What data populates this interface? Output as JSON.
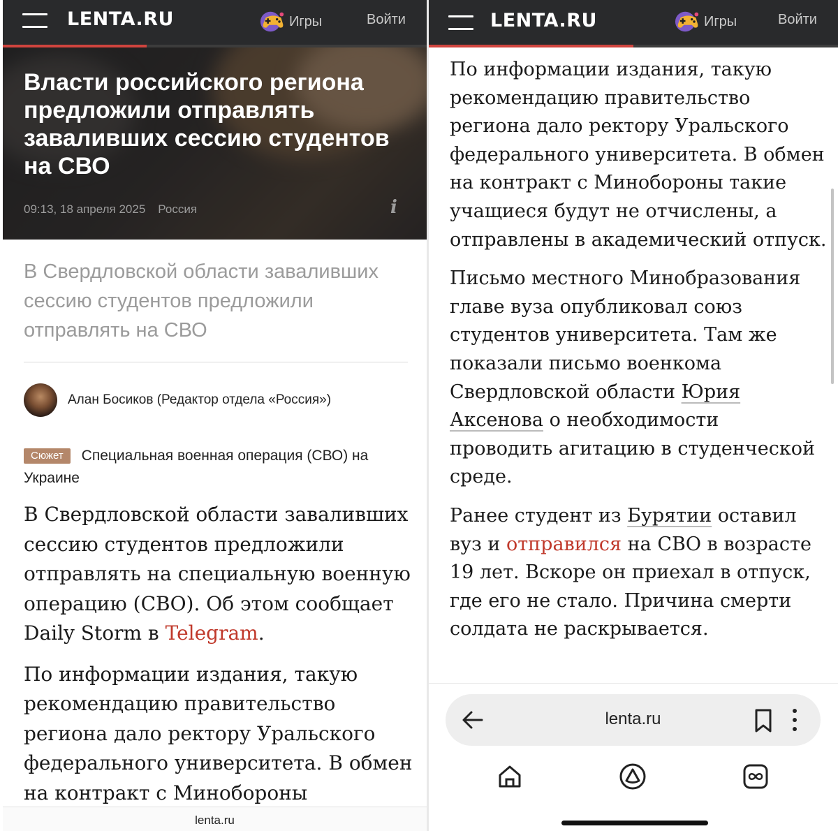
{
  "left": {
    "header": {
      "logo": "LENTA.RU",
      "games_label": "Игры",
      "login_label": "Войти"
    },
    "reading_progress_percent": 34,
    "article": {
      "title": "Власти российского региона предложили отправлять заваливших сессию студентов на СВО",
      "datetime": "09:13, 18 апреля 2025",
      "rubric": "Россия",
      "info_glyph": "i",
      "lead": "В Свердловской области заваливших сессию студентов предложили отправлять на СВО",
      "author": "Алан Босиков (Редактор отдела «Россия»)",
      "story_badge": "Сюжет",
      "story_title": "Специальная военная операция (СВО) на Украине",
      "p1_text": "В Свердловской области заваливших сессию студентов предложили отправлять на специальную военную операцию (СВО). Об этом сообщает Daily Storm в ",
      "p1_link": "Telegram",
      "p1_end": ".",
      "p2": "По информации издания, такую рекомендацию правительство региона дало ректору Уральского федерального университета. В обмен на контракт с Минобороны"
    },
    "footer_domain": "lenta.ru"
  },
  "right": {
    "header": {
      "logo": "LENTA.RU",
      "games_label": "Игры",
      "login_label": "Войти"
    },
    "reading_progress_percent": 50,
    "article": {
      "p1": "По информации издания, такую рекомендацию правительство региона дало ректору Уральского федерального университета. В обмен на контракт с Минобороны такие учащиеся будут не отчислены, а отправлены в академический отпуск.",
      "p2_a": "Письмо местного Минобразования главе вуза опубликовал союз студентов университета. Там же показали письмо военкома Свердловской области ",
      "p2_link": "Юрия Аксенова",
      "p2_b": " о необходимости проводить агитацию в студенческой среде.",
      "p3_a": "Ранее студент из ",
      "p3_link1": "Бурятии",
      "p3_b": " оставил вуз и ",
      "p3_link2": "отправился",
      "p3_c": " на СВО в возрасте 19 лет. Вскоре он приехал в отпуск, где его не стало. Причина смерти солдата не раскрывается."
    },
    "browser": {
      "url": "lenta.ru",
      "icons": [
        "back-arrow-icon",
        "bookmark-icon",
        "more-vertical-icon",
        "home-icon",
        "alice-icon",
        "tabs-icon"
      ]
    }
  },
  "colors": {
    "header_bg": "#292a2c",
    "accent_red": "#d0443e",
    "link_red": "#c0392b",
    "badge": "#b4876a"
  }
}
